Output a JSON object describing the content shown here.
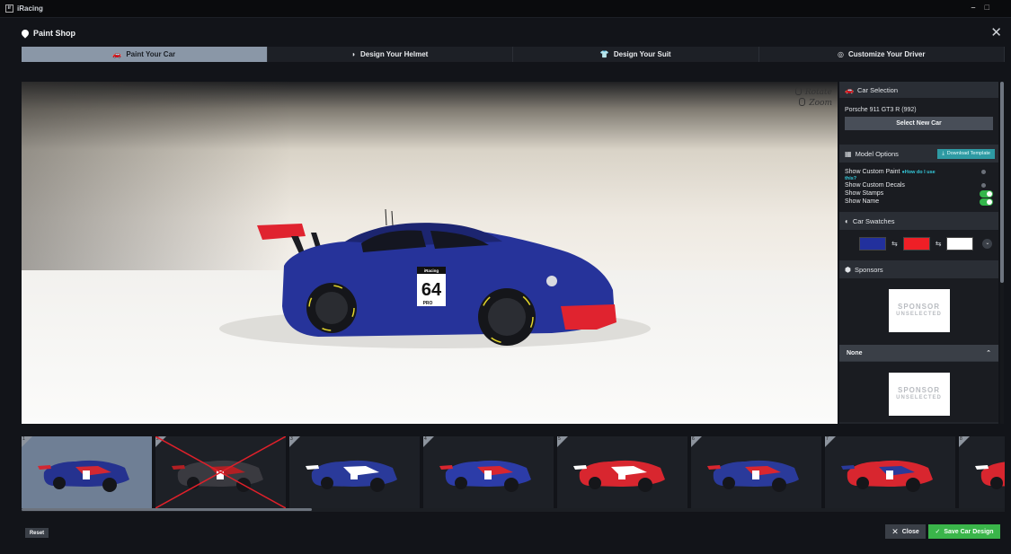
{
  "window": {
    "title": "iRacing",
    "controls": [
      "–",
      "□"
    ]
  },
  "dialog": {
    "title": "Paint Shop",
    "close_glyph": "✕"
  },
  "tabs": [
    {
      "label": "Paint Your Car",
      "icon": "car-icon",
      "active": true
    },
    {
      "label": "Design Your Helmet",
      "icon": "helmet-icon",
      "active": false
    },
    {
      "label": "Design Your Suit",
      "icon": "suit-icon",
      "active": false
    },
    {
      "label": "Customize Your Driver",
      "icon": "driver-icon",
      "active": false
    }
  ],
  "viewport": {
    "hints": {
      "rotate": "Rotate",
      "zoom": "Zoom"
    },
    "car": {
      "number": "64",
      "class_label": "PRO",
      "sponsor_strip": "iRacing",
      "body_color": "#26339a",
      "accent_color": "#e0232f"
    }
  },
  "sidebar": {
    "car_selection": {
      "header": "Car Selection",
      "car_name": "Porsche 911 GT3 R (992)",
      "button": "Select New Car"
    },
    "model_options": {
      "header": "Model Options",
      "download_button": "Download Template",
      "show_custom_paint": "Show Custom Paint",
      "how_link_a": "How do I use",
      "how_link_b": "this?",
      "show_custom_decals": "Show Custom Decals",
      "show_stamps": "Show Stamps",
      "show_name": "Show Name",
      "toggles": {
        "custom_paint": false,
        "custom_decals": false,
        "stamps": true,
        "name": true
      }
    },
    "car_swatches": {
      "header": "Car Swatches",
      "colors": [
        "#22309d",
        "#ef1f26",
        "#ffffff"
      ]
    },
    "sponsors": {
      "header": "Sponsors",
      "placeholder_line1": "SPONSOR",
      "placeholder_line2": "UNSELECTED",
      "dropdown_value": "None"
    }
  },
  "thumbnails": [
    {
      "n": "1",
      "selected": true,
      "colors": [
        "#25328f",
        "#d22732"
      ],
      "crossed": false
    },
    {
      "n": "2",
      "selected": false,
      "colors": [
        "#3a3a40",
        "#b21f23"
      ],
      "crossed": true
    },
    {
      "n": "3",
      "selected": false,
      "colors": [
        "#2a3a9a",
        "#ffffff"
      ],
      "crossed": false
    },
    {
      "n": "4",
      "selected": false,
      "colors": [
        "#2c3ca8",
        "#d8262f"
      ],
      "crossed": false
    },
    {
      "n": "5",
      "selected": false,
      "colors": [
        "#d8262f",
        "#ffffff"
      ],
      "crossed": false
    },
    {
      "n": "6",
      "selected": false,
      "colors": [
        "#2a3a9a",
        "#d8262f"
      ],
      "crossed": false
    },
    {
      "n": "7",
      "selected": false,
      "colors": [
        "#d8262f",
        "#2a3a9a"
      ],
      "crossed": false
    },
    {
      "n": "8",
      "selected": false,
      "colors": [
        "#d8262f",
        "#ffffff"
      ],
      "crossed": false
    }
  ],
  "footer": {
    "reset": "Reset",
    "close": "Close",
    "save": "Save Car Design"
  }
}
